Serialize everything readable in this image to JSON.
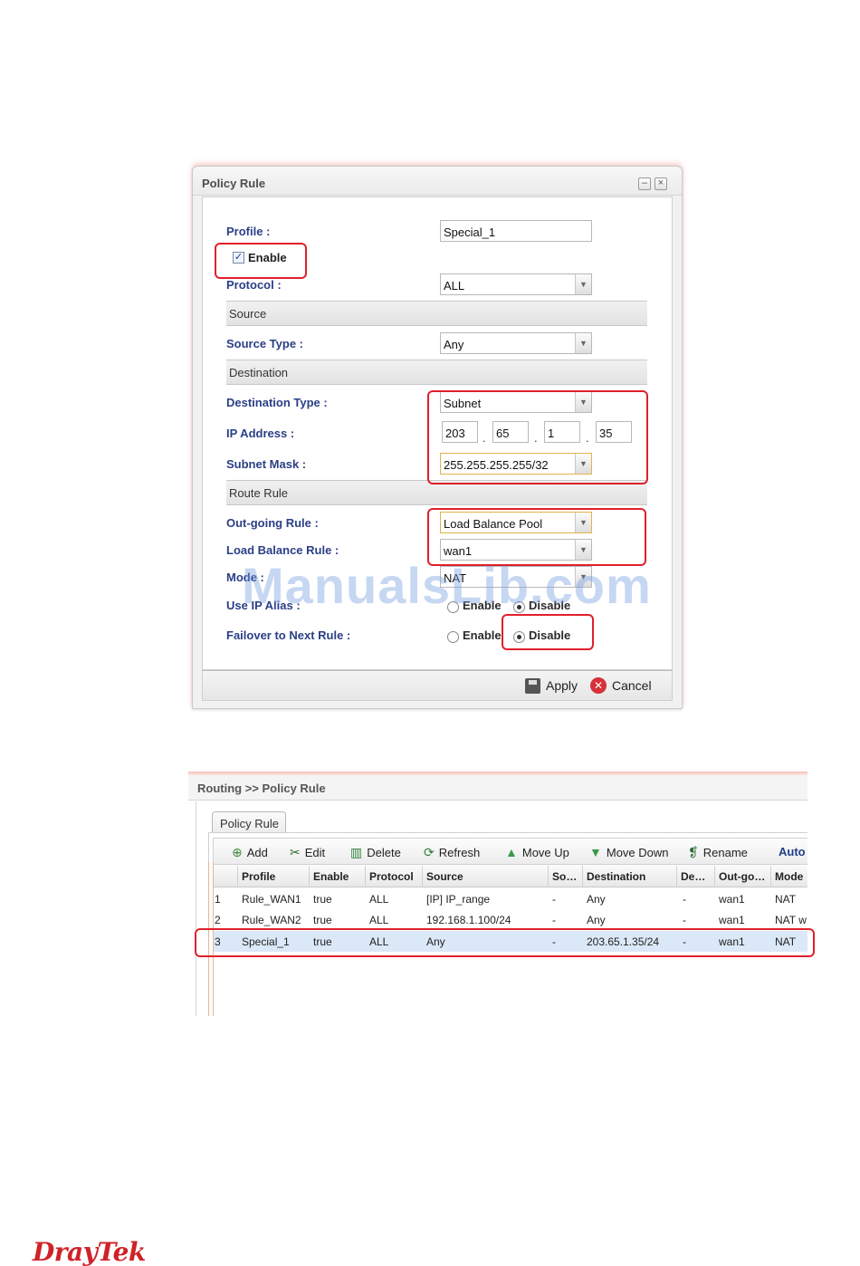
{
  "dialog": {
    "title": "Policy Rule",
    "minimize_glyph": "–",
    "close_glyph": "×",
    "profile": {
      "label": "Profile :",
      "value": "Special_1"
    },
    "enable": {
      "label": "Enable",
      "checked": true
    },
    "protocol": {
      "label": "Protocol :",
      "value": "ALL"
    },
    "source_section": "Source",
    "source_type": {
      "label": "Source Type :",
      "value": "Any"
    },
    "destination_section": "Destination",
    "destination_type": {
      "label": "Destination Type :",
      "value": "Subnet"
    },
    "ip_address": {
      "label": "IP Address :",
      "octets": [
        "203",
        "65",
        "1",
        "35"
      ],
      "separator": "."
    },
    "subnet_mask": {
      "label": "Subnet Mask :",
      "value": "255.255.255.255/32"
    },
    "route_section": "Route Rule",
    "outgoing_rule": {
      "label": "Out-going Rule :",
      "value": "Load Balance Pool"
    },
    "load_balance_rule": {
      "label": "Load Balance Rule :",
      "value": "wan1"
    },
    "mode": {
      "label": "Mode :",
      "value": "NAT"
    },
    "use_ip_alias": {
      "label": "Use IP Alias :",
      "options": [
        "Enable",
        "Disable"
      ],
      "selected": "Disable"
    },
    "failover": {
      "label": "Failover to Next Rule :",
      "options": [
        "Enable",
        "Disable"
      ],
      "selected": "Disable"
    },
    "apply_label": "Apply",
    "cancel_label": "Cancel"
  },
  "watermark": "ManualsLib.com",
  "list_panel": {
    "breadcrumb": "Routing >> Policy Rule",
    "tab": "Policy Rule",
    "toolbar": [
      "Add",
      "Edit",
      "Delete",
      "Refresh",
      "Move Up",
      "Move Down",
      "Rename",
      "Auto l"
    ],
    "columns": [
      "Profile",
      "Enable",
      "Protocol",
      "Source",
      "So…",
      "Destination",
      "De…",
      "Out-go…",
      "Mode"
    ],
    "rows": [
      {
        "no": "1",
        "profile": "Rule_WAN1",
        "enable": "true",
        "protocol": "ALL",
        "source": "[IP] IP_range",
        "so": "-",
        "destination": "Any",
        "de": "-",
        "outgoing": "wan1",
        "mode": "NAT"
      },
      {
        "no": "2",
        "profile": "Rule_WAN2",
        "enable": "true",
        "protocol": "ALL",
        "source": "192.168.1.100/24",
        "so": "-",
        "destination": "Any",
        "de": "-",
        "outgoing": "wan1",
        "mode": "NAT w"
      },
      {
        "no": "3",
        "profile": "Special_1",
        "enable": "true",
        "protocol": "ALL",
        "source": "Any",
        "so": "-",
        "destination": "203.65.1.35/24",
        "de": "-",
        "outgoing": "wan1",
        "mode": "NAT"
      }
    ]
  },
  "logo": "DrayTek",
  "colors": {
    "highlight_red": "#e0202a",
    "label_blue": "#2a3f86",
    "logo_red": "#cf2228"
  }
}
